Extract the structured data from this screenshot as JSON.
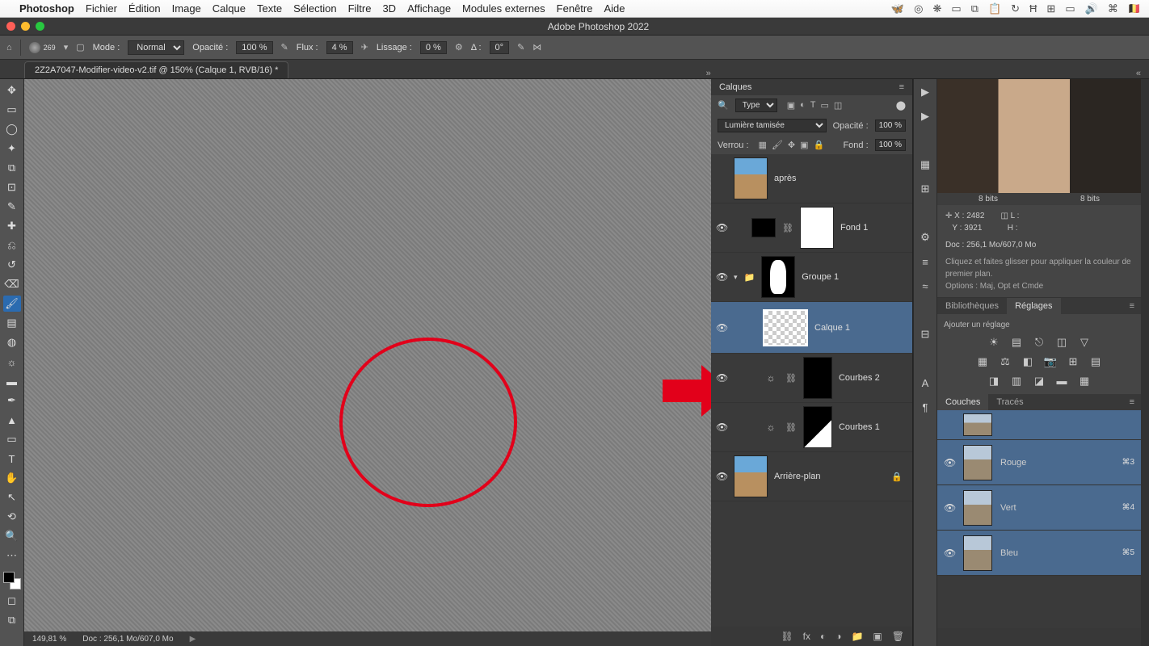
{
  "menubar": {
    "app": "Photoshop",
    "items": [
      "Fichier",
      "Édition",
      "Image",
      "Calque",
      "Texte",
      "Sélection",
      "Filtre",
      "3D",
      "Affichage",
      "Modules externes",
      "Fenêtre",
      "Aide"
    ]
  },
  "titlebar": {
    "title": "Adobe Photoshop 2022"
  },
  "optionsbar": {
    "brush_size": "269",
    "mode_label": "Mode :",
    "mode_value": "Normal",
    "opacity_label": "Opacité :",
    "opacity_value": "100 %",
    "flux_label": "Flux :",
    "flux_value": "4 %",
    "lissage_label": "Lissage :",
    "lissage_value": "0 %",
    "angle_label": "Δ :",
    "angle_value": "0°"
  },
  "tab": {
    "title": "2Z2A7047-Modifier-video-v2.tif @ 150% (Calque 1, RVB/16) *"
  },
  "status": {
    "zoom": "149,81 %",
    "doc": "Doc : 256,1 Mo/607,0 Mo"
  },
  "layers_panel": {
    "title": "Calques",
    "kind_label": "Type",
    "blend_mode": "Lumière tamisée",
    "opacity_label": "Opacité :",
    "opacity_value": "100 %",
    "lock_label": "Verrou :",
    "fill_label": "Fond :",
    "fill_value": "100 %",
    "layers": [
      {
        "name": "après"
      },
      {
        "name": "Fond 1"
      },
      {
        "name": "Groupe 1"
      },
      {
        "name": "Calque 1"
      },
      {
        "name": "Courbes 2"
      },
      {
        "name": "Courbes 1"
      },
      {
        "name": "Arrière-plan"
      }
    ]
  },
  "right": {
    "bits_left": "8 bits",
    "bits_right": "8 bits",
    "coord": {
      "x_label": "X :",
      "x": "2482",
      "y_label": "Y :",
      "y": "3921",
      "w_label": "L :",
      "h_label": "H :"
    },
    "doc_size": "Doc : 256,1 Mo/607,0 Mo",
    "hint1": "Cliquez et faites glisser pour appliquer la couleur de premier plan.",
    "hint2": "Options : Maj, Opt et Cmde",
    "tab_lib": "Bibliothèques",
    "tab_reg": "Réglages",
    "add_label": "Ajouter un réglage",
    "ch_tab1": "Couches",
    "ch_tab2": "Tracés",
    "channels": [
      {
        "name": "",
        "shortcut": ""
      },
      {
        "name": "Rouge",
        "shortcut": "⌘3"
      },
      {
        "name": "Vert",
        "shortcut": "⌘4"
      },
      {
        "name": "Bleu",
        "shortcut": "⌘5"
      }
    ]
  }
}
